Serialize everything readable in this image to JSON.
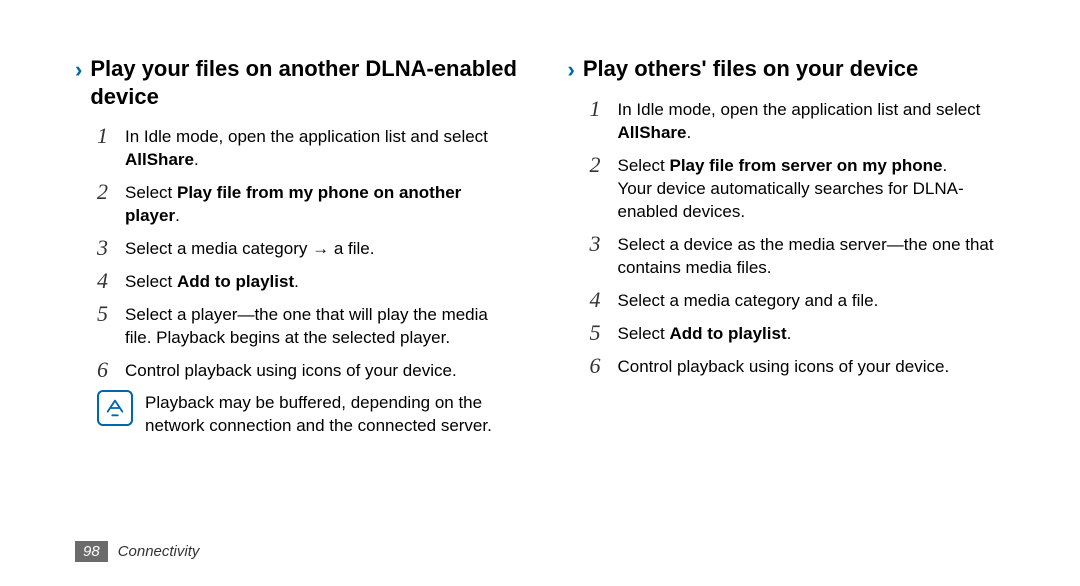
{
  "left": {
    "heading": "Play your files on another DLNA-enabled device",
    "steps": [
      {
        "num": "1",
        "pre": "In Idle mode, open the application list and select ",
        "bold": "AllShare",
        "post": "."
      },
      {
        "num": "2",
        "pre": "Select ",
        "bold": "Play file from my phone on another player",
        "post": "."
      },
      {
        "num": "3",
        "text": "Select a media category → a file."
      },
      {
        "num": "4",
        "pre": "Select ",
        "bold": "Add to playlist",
        "post": "."
      },
      {
        "num": "5",
        "text": "Select a player—the one that will play the media file. Playback begins at the selected player."
      },
      {
        "num": "6",
        "text": "Control playback using icons of your device."
      }
    ],
    "note": "Playback may be buffered, depending on the network connection and the connected server."
  },
  "right": {
    "heading": "Play others' files on your device",
    "steps": [
      {
        "num": "1",
        "pre": "In Idle mode, open the application list and select ",
        "bold": "AllShare",
        "post": "."
      },
      {
        "num": "2",
        "pre": "Select ",
        "bold": "Play file from server on my phone",
        "post": ".",
        "extra": "Your device automatically searches for DLNA-enabled devices."
      },
      {
        "num": "3",
        "text": "Select a device as the media server—the one that contains media files."
      },
      {
        "num": "4",
        "text": "Select a media category and a file."
      },
      {
        "num": "5",
        "pre": "Select ",
        "bold": "Add to playlist",
        "post": "."
      },
      {
        "num": "6",
        "text": "Control playback using icons of your device."
      }
    ]
  },
  "footer": {
    "page": "98",
    "section": "Connectivity"
  }
}
